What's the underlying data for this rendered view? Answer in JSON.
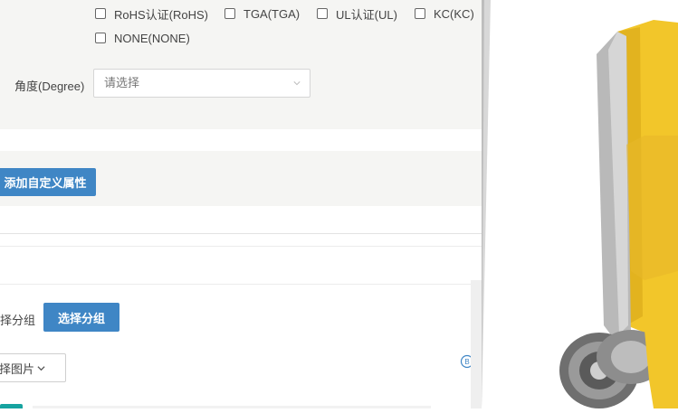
{
  "certifications": {
    "options": [
      {
        "label": "RoHS认证(RoHS)",
        "checked": false
      },
      {
        "label": "TGA(TGA)",
        "checked": false
      },
      {
        "label": "UL认证(UL)",
        "checked": false
      },
      {
        "label": "KC(KC)",
        "checked": false
      },
      {
        "label": "NONE(NONE)",
        "checked": false
      }
    ]
  },
  "angle": {
    "label": "角度(Degree)",
    "placeholder": "请选择"
  },
  "custom_attr_button": "添加自定义属性",
  "group": {
    "label": "择分组",
    "button": "选择分组"
  },
  "image_button": {
    "label": "择图片"
  },
  "colors": {
    "primary_blue": "#3f86c5",
    "form_bg": "#f5f5f3",
    "product_yellow": "#f2c62a",
    "teal_tag": "#16a3a0"
  },
  "icons": {
    "select_arrow": "chevron-down-icon",
    "image_dropdown": "chevron-down-icon",
    "help": "info-circle-icon"
  }
}
